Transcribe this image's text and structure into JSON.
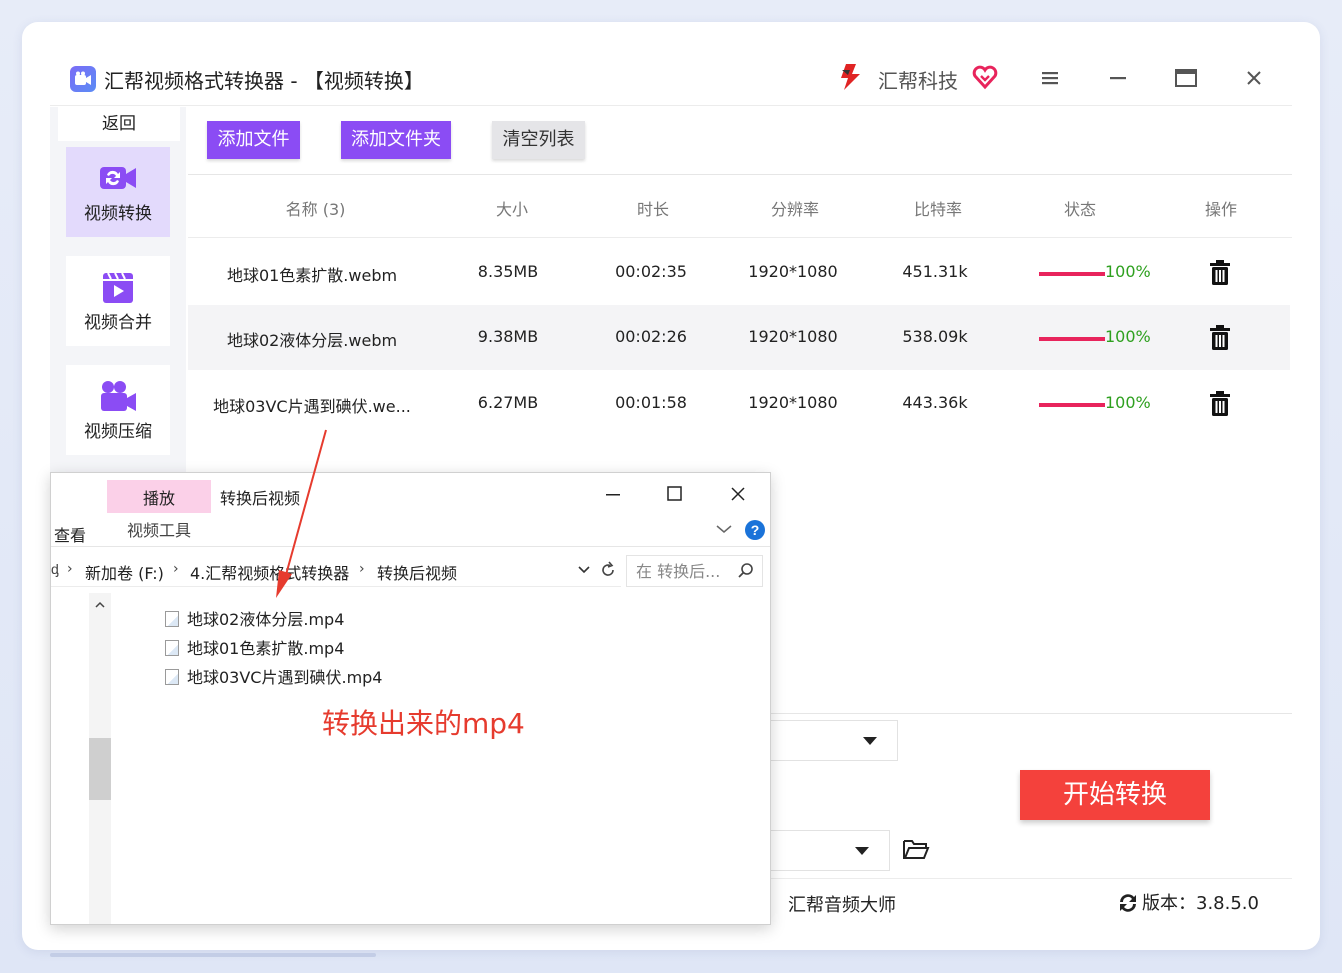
{
  "app": {
    "title": "汇帮视频格式转换器  -  【视频转换】",
    "brand": "汇帮科技"
  },
  "sidebar": {
    "back_label": "返回",
    "items": [
      {
        "label": "视频转换",
        "icon": "video-convert-icon",
        "active": true
      },
      {
        "label": "视频合并",
        "icon": "video-merge-icon",
        "active": false
      },
      {
        "label": "视频压缩",
        "icon": "video-compress-icon",
        "active": false
      }
    ]
  },
  "toolbar": {
    "add_file": "添加文件",
    "add_folder": "添加文件夹",
    "clear_list": "清空列表"
  },
  "table": {
    "headers": [
      "名称 (3)",
      "大小",
      "时长",
      "分辨率",
      "比特率",
      "状态",
      "操作"
    ],
    "rows": [
      {
        "name": "地球01色素扩散.webm",
        "size": "8.35MB",
        "duration": "00:02:35",
        "resolution": "1920*1080",
        "bitrate": "451.31k",
        "progress": 1.0,
        "status": "100%"
      },
      {
        "name": "地球02液体分层.webm",
        "size": "9.38MB",
        "duration": "00:02:26",
        "resolution": "1920*1080",
        "bitrate": "538.09k",
        "progress": 1.0,
        "status": "100%"
      },
      {
        "name": "地球03VC片遇到碘伏.we...",
        "size": "6.27MB",
        "duration": "00:01:58",
        "resolution": "1920*1080",
        "bitrate": "443.36k",
        "progress": 1.0,
        "status": "100%"
      }
    ]
  },
  "actions": {
    "start": "开始转换"
  },
  "footer": {
    "link": "汇帮音频大师",
    "version": "版本：3.8.5.0"
  },
  "explorer": {
    "tab_play": "播放",
    "title": "转换后视频",
    "tab_view": "查看",
    "tab_video_tools": "视频工具",
    "path": [
      "新加卷 (F:)",
      "4.汇帮视频格式转换器",
      "转换后视频"
    ],
    "path_lead": "ᶁ",
    "search_placeholder": "在 转换后...",
    "files": [
      "地球02液体分层.mp4",
      "地球01色素扩散.mp4",
      "地球03VC片遇到碘伏.mp4"
    ]
  },
  "annotation": "转换出来的mp4",
  "colors": {
    "accent_purple": "#8b4cf4",
    "start_red": "#f4413c",
    "progress_pink": "#e8245c",
    "status_green": "#2ea01f",
    "annotation_red": "#e63b2e"
  }
}
